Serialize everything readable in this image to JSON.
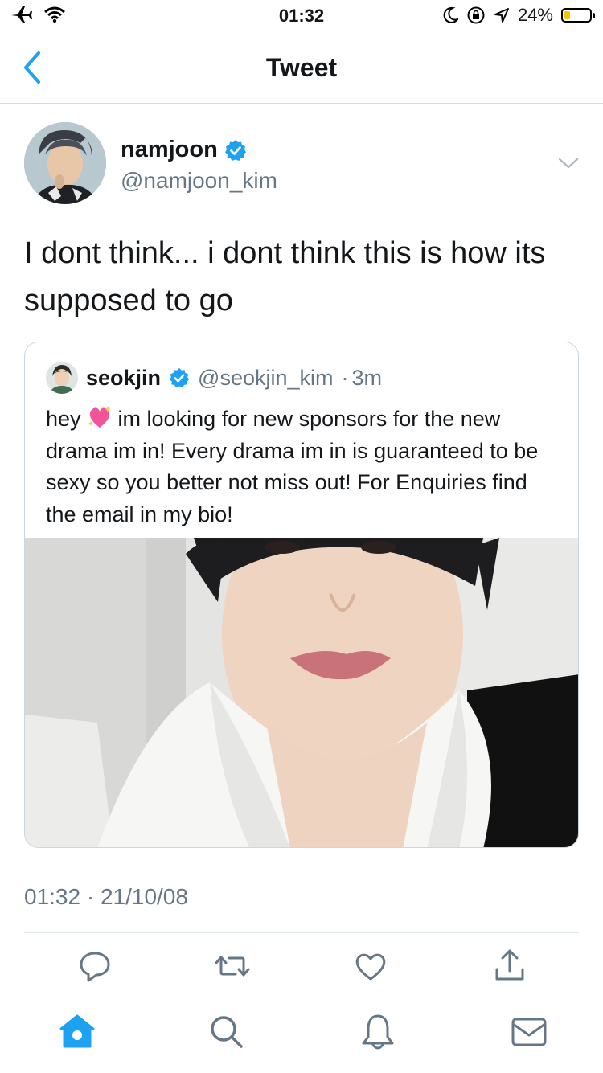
{
  "status_bar": {
    "time": "01:32",
    "battery_percent": "24%",
    "battery_level": 0.24,
    "icons": [
      "airplane-icon",
      "wifi-icon",
      "moon-icon",
      "rotation-lock-icon",
      "location-icon",
      "battery-icon"
    ]
  },
  "nav": {
    "title": "Tweet",
    "back_icon": "chevron-left-icon"
  },
  "tweet": {
    "author_name": "namjoon",
    "author_handle": "@namjoon_kim",
    "verified": true,
    "text": "I dont think... i dont think this is how its supposed to go",
    "timestamp": "01:32 · 21/10/08"
  },
  "quoted_tweet": {
    "author_name": "seokjin",
    "author_handle": "@seokjin_kim",
    "separator": "·",
    "age": "3m",
    "text_before_emoji": "hey",
    "emoji": "sparkling-heart",
    "text_after_emoji": "im looking for new sponsors for the new drama im in! Every drama im in is guaranteed to be sexy so you better not miss out! For Enquiries find the email in my bio!"
  },
  "actions": [
    "reply-icon",
    "retweet-icon",
    "like-icon",
    "share-icon"
  ],
  "tabs": [
    "home-icon",
    "search-icon",
    "notifications-icon",
    "messages-icon"
  ],
  "colors": {
    "accent": "#1da1f2",
    "text_primary": "#14171a",
    "text_secondary": "#657786",
    "battery_yellow": "#f5c400"
  }
}
